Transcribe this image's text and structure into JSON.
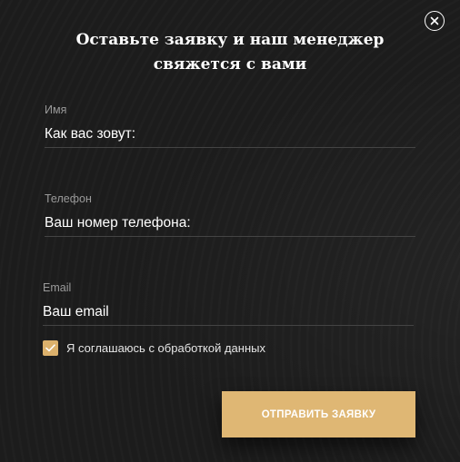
{
  "form": {
    "title_line1": "Оставьте заявку и наш менеджер",
    "title_line2": "свяжется с вами",
    "close_icon": "close-icon",
    "fields": {
      "name": {
        "label": "Имя",
        "placeholder": "Как вас зовут:",
        "value": ""
      },
      "phone": {
        "label": "Телефон",
        "placeholder": "Ваш номер телефона:",
        "value": ""
      },
      "email": {
        "label": "Email",
        "placeholder": "Ваш email",
        "value": ""
      }
    },
    "consent": {
      "label": "Я соглашаюсь с обработкой данных",
      "checked": true
    },
    "submit_label": "ОТПРАВИТЬ ЗАЯВКУ"
  },
  "colors": {
    "background": "#1c1c1c",
    "accent": "#dfb774",
    "text": "#ffffff",
    "muted": "#9a9a9a",
    "divider": "#444444"
  }
}
